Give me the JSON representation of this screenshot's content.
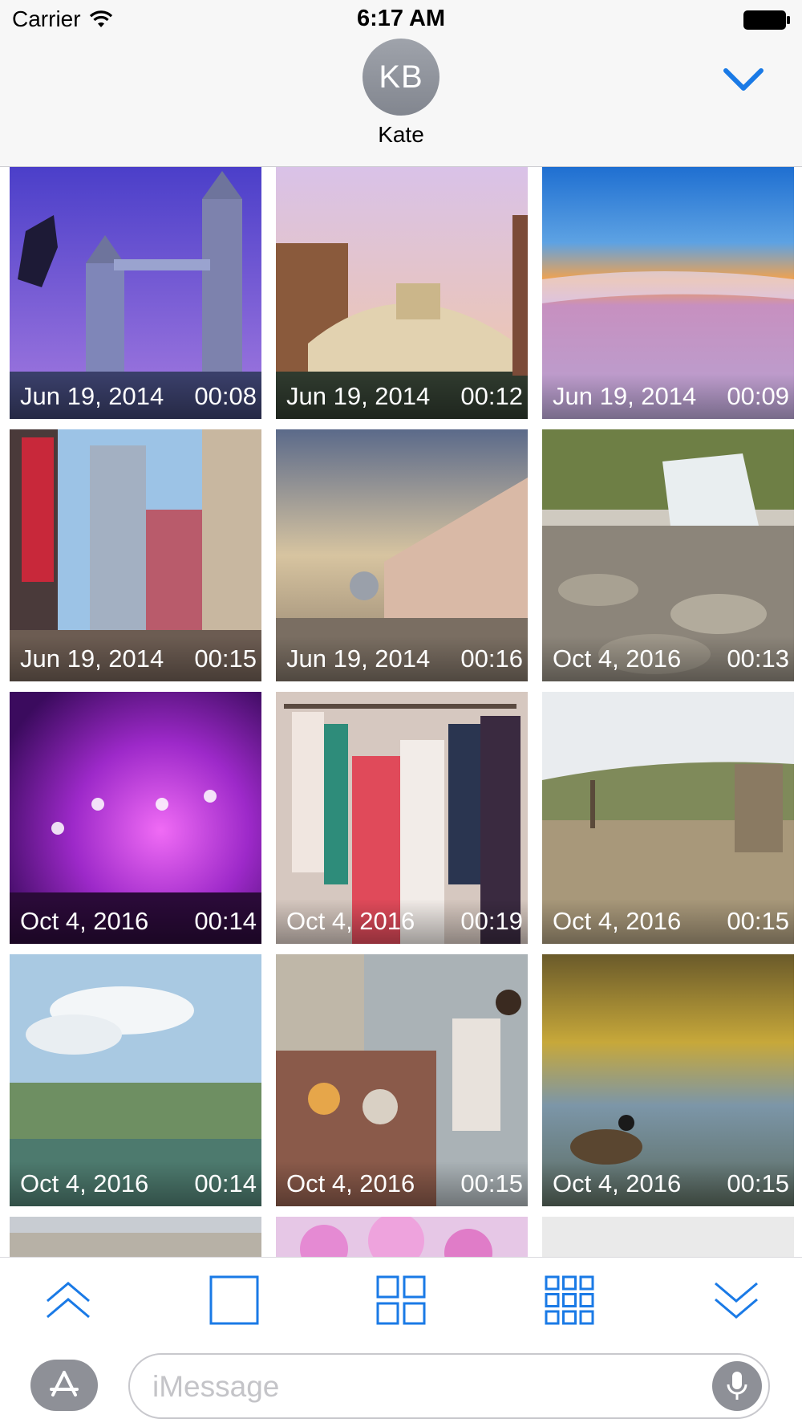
{
  "status_bar": {
    "carrier": "Carrier",
    "time": "6:17 AM"
  },
  "header": {
    "avatar_initials": "KB",
    "contact_name": "Kate"
  },
  "videos": [
    {
      "date": "Jun 19, 2014",
      "duration": "00:08",
      "scene": "tower-bridge"
    },
    {
      "date": "Jun 19, 2014",
      "duration": "00:12",
      "scene": "rialto-bridge"
    },
    {
      "date": "Jun 19, 2014",
      "duration": "00:09",
      "scene": "sunset-beach"
    },
    {
      "date": "Jun 19, 2014",
      "duration": "00:15",
      "scene": "times-square"
    },
    {
      "date": "Jun 19, 2014",
      "duration": "00:16",
      "scene": "doges-palace"
    },
    {
      "date": "Oct 4, 2016",
      "duration": "00:13",
      "scene": "waterfall-rocks"
    },
    {
      "date": "Oct 4, 2016",
      "duration": "00:14",
      "scene": "concert-lights"
    },
    {
      "date": "Oct 4, 2016",
      "duration": "00:19",
      "scene": "clothes-rack"
    },
    {
      "date": "Oct 4, 2016",
      "duration": "00:15",
      "scene": "countryside-fence"
    },
    {
      "date": "Oct 4, 2016",
      "duration": "00:14",
      "scene": "sky-algae"
    },
    {
      "date": "Oct 4, 2016",
      "duration": "00:15",
      "scene": "crowd-riverbank"
    },
    {
      "date": "Oct 4, 2016",
      "duration": "00:15",
      "scene": "goose-water"
    },
    {
      "scene": "city-rooftops"
    },
    {
      "scene": "pink-blossoms"
    },
    {
      "scene": "white-wall"
    }
  ],
  "toolbar": {
    "icons": [
      "chevron-up-icon",
      "single-square-icon",
      "grid-2x2-icon",
      "grid-3x3-icon",
      "chevron-down-icon"
    ],
    "accent_color": "#1a7ae6"
  },
  "input_bar": {
    "placeholder": "iMessage"
  }
}
